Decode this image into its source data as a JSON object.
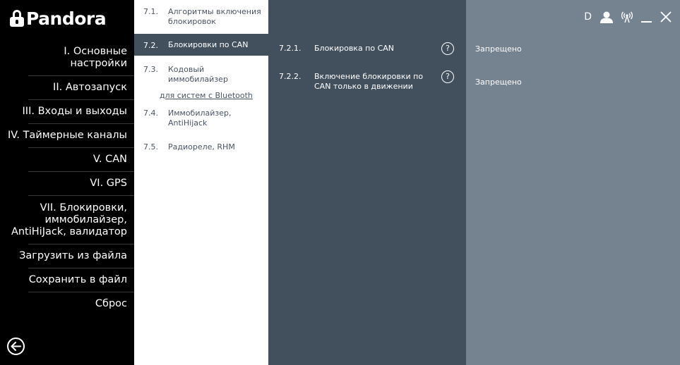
{
  "logo": {
    "text": "Pandora"
  },
  "sidebar": {
    "items": [
      {
        "label": "I. Основные настройки"
      },
      {
        "label": "II. Автозапуск"
      },
      {
        "label": "III. Входы и выходы"
      },
      {
        "label": "IV. Таймерные каналы"
      },
      {
        "label": "V. CAN"
      },
      {
        "label": "VI. GPS"
      },
      {
        "label": "VII. Блокировки, иммобилайзер, AntiHiJack, валидатор"
      },
      {
        "label": "Загрузить из файла"
      },
      {
        "label": "Сохранить в файл"
      },
      {
        "label": "Сброс"
      }
    ]
  },
  "subnav": {
    "items": [
      {
        "num": "7.1.",
        "label": "Алгоритмы включения блокировок"
      },
      {
        "num": "7.2.",
        "label": "Блокировки по CAN"
      },
      {
        "num": "7.3.",
        "label": "Кодовый иммобилайзер"
      },
      {
        "num": "7.4.",
        "label": "Иммобилайзер, AntiHijack"
      },
      {
        "num": "7.5.",
        "label": "Радиореле, RHM"
      }
    ],
    "bluetooth_link": "для систем с Bluetooth"
  },
  "settings": {
    "rows": [
      {
        "num": "7.2.1.",
        "label": "Блокировка по CAN",
        "value": "Запрещено"
      },
      {
        "num": "7.2.2.",
        "label": "Включение блокировки по CAN только в движении",
        "value": "Запрещено"
      }
    ],
    "help": "?"
  },
  "topbar": {
    "device_letter": "D"
  },
  "colors": {
    "sidebar": "#000000",
    "subnav": "#ffffff",
    "active": "#42505e",
    "settings": "#42505e",
    "values": "#758290"
  }
}
